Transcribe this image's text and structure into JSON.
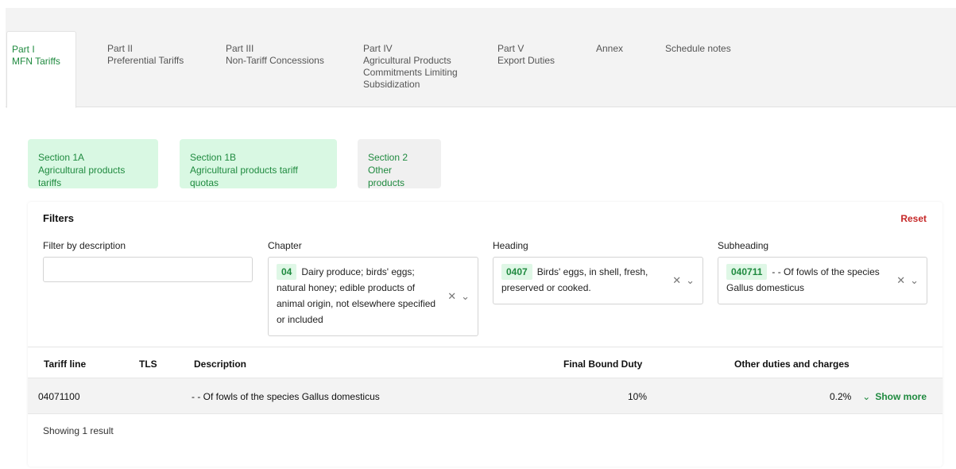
{
  "tabs": [
    {
      "line1": "Part I",
      "line2": "MFN Tariffs"
    },
    {
      "line1": "Part II",
      "line2": "Preferential Tariffs"
    },
    {
      "line1": "Part III",
      "line2": "Non-Tariff Concessions"
    },
    {
      "line1": "Part IV",
      "line2": "Agricultural Products",
      "line3": "Commitments Limiting",
      "line4": "Subsidization"
    },
    {
      "line1": "Part V",
      "line2": "Export Duties"
    },
    {
      "line1": "Annex"
    },
    {
      "line1": "Schedule notes"
    }
  ],
  "sections": [
    {
      "line1": "Section 1A",
      "line2": "Agricultural products tariffs"
    },
    {
      "line1": "Section 1B",
      "line2": "Agricultural products tariff quotas"
    },
    {
      "line1": "Section 2",
      "line2": "Other products"
    }
  ],
  "filters": {
    "title": "Filters",
    "reset": "Reset",
    "description_label": "Filter by description",
    "description_value": "",
    "chapter_label": "Chapter",
    "chapter_code": "04",
    "chapter_text": "Dairy produce; birds' eggs; natural honey; edible products of animal origin, not elsewhere specified or included",
    "heading_label": "Heading",
    "heading_code": "0407",
    "heading_text": "Birds' eggs, in shell, fresh, preserved or cooked.",
    "subheading_label": "Subheading",
    "subheading_code": "040711",
    "subheading_text": "- - Of fowls of the species Gallus domesticus",
    "clear_glyph": "✕",
    "chevron_glyph": "⌄"
  },
  "table": {
    "headers": {
      "tariff_line": "Tariff line",
      "tls": "TLS",
      "description": "Description",
      "final_bound_duty": "Final Bound Duty",
      "other_duties": "Other duties and charges"
    },
    "rows": [
      {
        "tariff_line": "04071100",
        "tls": "",
        "description": "- - Of fowls of the species Gallus domesticus",
        "final_bound_duty": "10%",
        "other_duties": "0.2%",
        "show_more": "Show more"
      }
    ],
    "result_count": "Showing 1 result"
  },
  "colors": {
    "accent_green": "#1f8a3f",
    "section_green_bg": "#d9f8e3",
    "reset_red": "#c62828"
  }
}
